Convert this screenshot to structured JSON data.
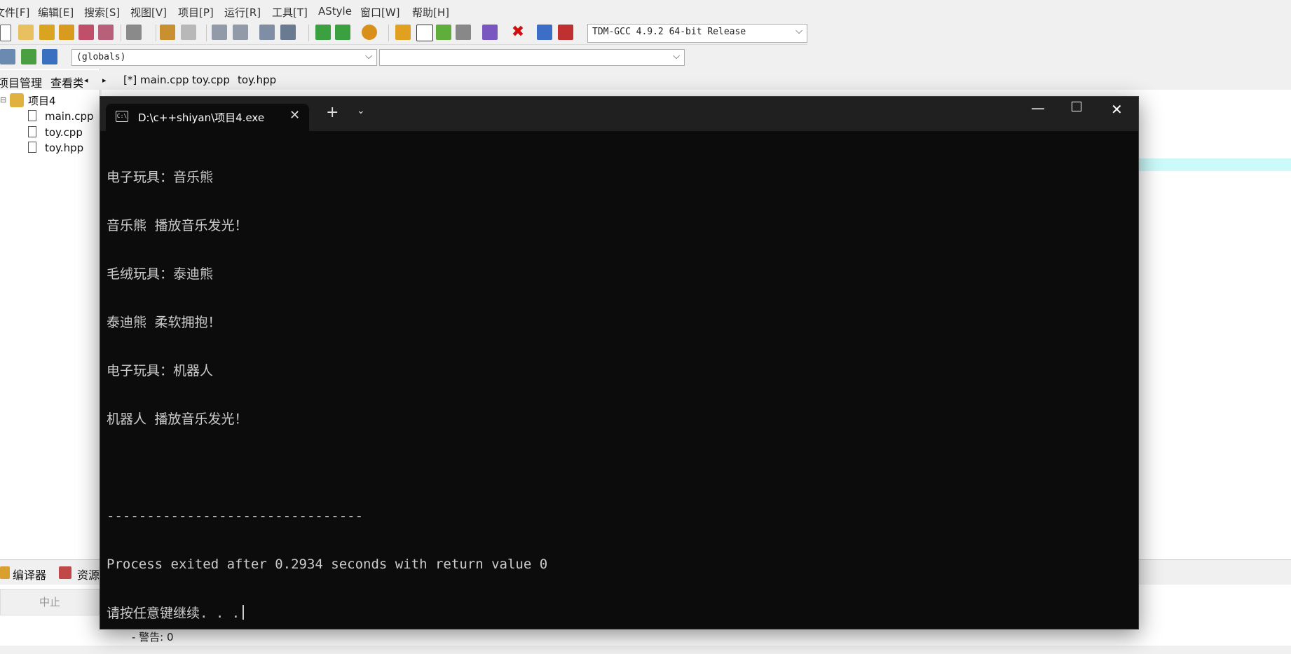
{
  "menu": [
    "文件[F]",
    "编辑[E]",
    "搜索[S]",
    "视图[V]",
    "项目[P]",
    "运行[R]",
    "工具[T]",
    "AStyle",
    "窗口[W]",
    "帮助[H]"
  ],
  "toolbar": {
    "compiler_select": "TDM-GCC 4.9.2 64-bit Release",
    "scope_select": "(globals)",
    "symbol_select": ""
  },
  "left_tabs": {
    "project": "项目管理",
    "view": "查看类"
  },
  "project_tree": {
    "root": "项目4",
    "files": [
      "main.cpp",
      "toy.cpp",
      "toy.hpp"
    ]
  },
  "editor_tabs": [
    "[*] main.cpp",
    "toy.cpp",
    "toy.hpp"
  ],
  "bottom_tabs": {
    "compiler": "编译器",
    "resources": "资源"
  },
  "stop_button": "中止",
  "warnings_line": "- 警告: 0",
  "terminal": {
    "title": "D:\\c++shiyan\\项目4.exe",
    "lines": [
      "电子玩具：音乐熊",
      "音乐熊 播放音乐发光！",
      "毛绒玩具：泰迪熊",
      "泰迪熊 柔软拥抱！",
      "电子玩具：机器人",
      "机器人 播放音乐发光！",
      "",
      "--------------------------------",
      "Process exited after 0.2934 seconds with return value 0",
      "请按任意键继续. . ."
    ]
  }
}
